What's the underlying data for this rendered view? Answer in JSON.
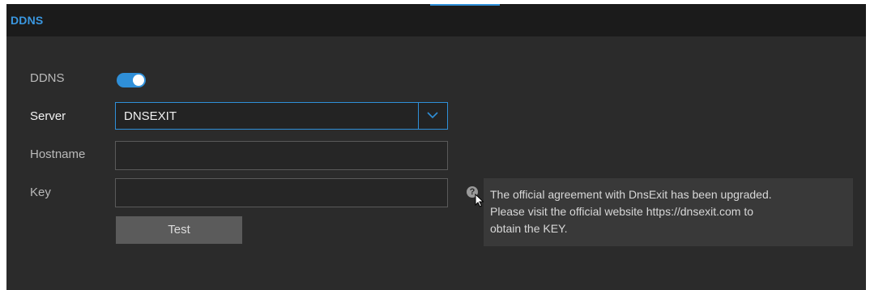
{
  "header": {
    "title": "DDNS"
  },
  "form": {
    "ddns_label": "DDNS",
    "ddns_enabled": true,
    "server_label": "Server",
    "server_value": "DNSEXIT",
    "hostname_label": "Hostname",
    "hostname_value": "",
    "key_label": "Key",
    "key_value": "",
    "test_button": "Test"
  },
  "tooltip": {
    "line1": "The official agreement with DnsExit has been upgraded.",
    "line2": "Please visit the official website https://dnsexit.com to",
    "line3": "obtain the KEY."
  },
  "colors": {
    "accent": "#2f8fd8",
    "background": "#2b2b2b",
    "header_background": "#1b1b1b"
  },
  "icons": {
    "help": "question-circle-icon",
    "cursor": "mouse-pointer-icon",
    "dropdown": "chevron-down-icon"
  }
}
